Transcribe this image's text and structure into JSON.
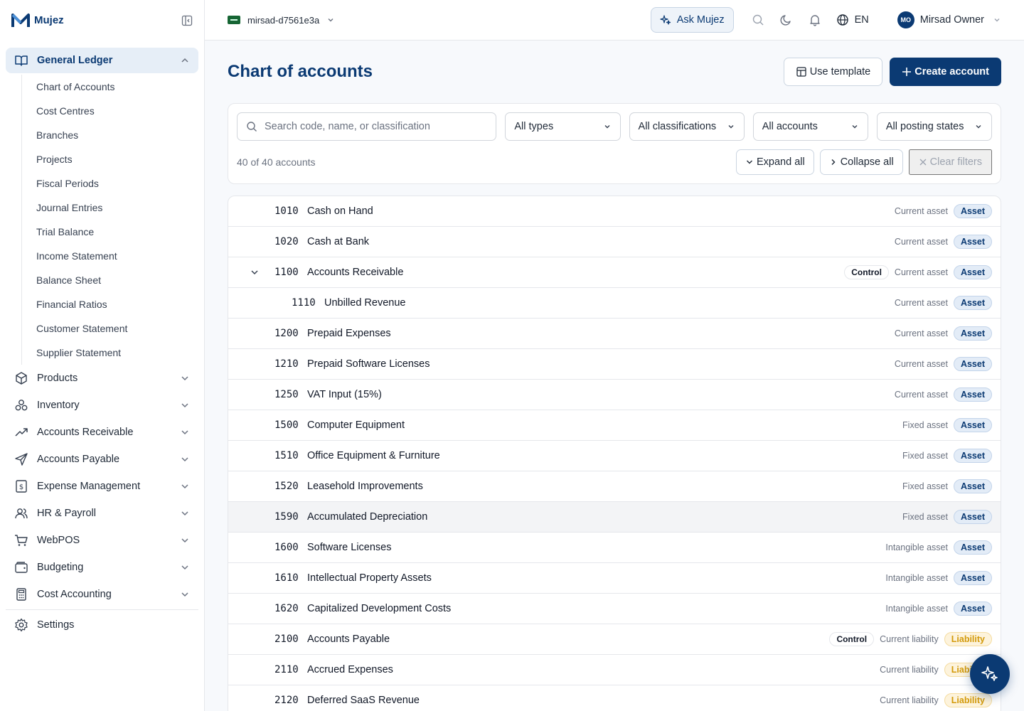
{
  "brand": {
    "name": "Mujez"
  },
  "sidebar": {
    "active_group": {
      "label": "General Ledger"
    },
    "sub_items": [
      "Chart of Accounts",
      "Cost Centres",
      "Branches",
      "Projects",
      "Fiscal Periods",
      "Journal Entries",
      "Trial Balance",
      "Income Statement",
      "Balance Sheet",
      "Financial Ratios",
      "Customer Statement",
      "Supplier Statement"
    ],
    "groups": [
      {
        "label": "Products",
        "icon": "box-icon"
      },
      {
        "label": "Inventory",
        "icon": "boxes-icon"
      },
      {
        "label": "Accounts Receivable",
        "icon": "trending-up-icon"
      },
      {
        "label": "Accounts Payable",
        "icon": "send-icon"
      },
      {
        "label": "Expense Management",
        "icon": "receipt-icon"
      },
      {
        "label": "HR & Payroll",
        "icon": "users-icon"
      },
      {
        "label": "WebPOS",
        "icon": "cart-icon"
      },
      {
        "label": "Budgeting",
        "icon": "wallet-icon"
      },
      {
        "label": "Cost Accounting",
        "icon": "calculator-icon"
      }
    ],
    "settings": {
      "label": "Settings"
    }
  },
  "topbar": {
    "org": "mirsad-d7561e3a",
    "ask": "Ask Mujez",
    "lang": "EN",
    "user_initials": "MO",
    "user_name": "Mirsad Owner"
  },
  "page": {
    "title": "Chart of accounts",
    "use_template": "Use template",
    "create_account": "Create account"
  },
  "filters": {
    "search_placeholder": "Search code, name, or classification",
    "types": "All types",
    "classifications": "All classifications",
    "accounts": "All accounts",
    "posting": "All posting states",
    "count": "40 of 40 accounts",
    "expand_all": "Expand all",
    "collapse_all": "Collapse all",
    "clear_filters": "Clear filters"
  },
  "accounts": [
    {
      "code": "1010",
      "name": "Cash on Hand",
      "classification": "Current asset",
      "type": "Asset"
    },
    {
      "code": "1020",
      "name": "Cash at Bank",
      "classification": "Current asset",
      "type": "Asset"
    },
    {
      "code": "1100",
      "name": "Accounts Receivable",
      "classification": "Current asset",
      "type": "Asset",
      "control": "Control",
      "expanded": true
    },
    {
      "code": "1110",
      "name": "Unbilled Revenue",
      "classification": "Current asset",
      "type": "Asset",
      "child": true
    },
    {
      "code": "1200",
      "name": "Prepaid Expenses",
      "classification": "Current asset",
      "type": "Asset"
    },
    {
      "code": "1210",
      "name": "Prepaid Software Licenses",
      "classification": "Current asset",
      "type": "Asset"
    },
    {
      "code": "1250",
      "name": "VAT Input (15%)",
      "classification": "Current asset",
      "type": "Asset"
    },
    {
      "code": "1500",
      "name": "Computer Equipment",
      "classification": "Fixed asset",
      "type": "Asset"
    },
    {
      "code": "1510",
      "name": "Office Equipment & Furniture",
      "classification": "Fixed asset",
      "type": "Asset"
    },
    {
      "code": "1520",
      "name": "Leasehold Improvements",
      "classification": "Fixed asset",
      "type": "Asset"
    },
    {
      "code": "1590",
      "name": "Accumulated Depreciation",
      "classification": "Fixed asset",
      "type": "Asset",
      "hover": true
    },
    {
      "code": "1600",
      "name": "Software Licenses",
      "classification": "Intangible asset",
      "type": "Asset"
    },
    {
      "code": "1610",
      "name": "Intellectual Property Assets",
      "classification": "Intangible asset",
      "type": "Asset"
    },
    {
      "code": "1620",
      "name": "Capitalized Development Costs",
      "classification": "Intangible asset",
      "type": "Asset"
    },
    {
      "code": "2100",
      "name": "Accounts Payable",
      "classification": "Current liability",
      "type": "Liability",
      "control": "Control"
    },
    {
      "code": "2110",
      "name": "Accrued Expenses",
      "classification": "Current liability",
      "type": "Liability"
    },
    {
      "code": "2120",
      "name": "Deferred SaaS Revenue",
      "classification": "Current liability",
      "type": "Liability"
    }
  ],
  "colors": {
    "brand": "#0b3a73",
    "asset_bg": "#e3ecf7",
    "liability_text": "#d39a0a"
  }
}
